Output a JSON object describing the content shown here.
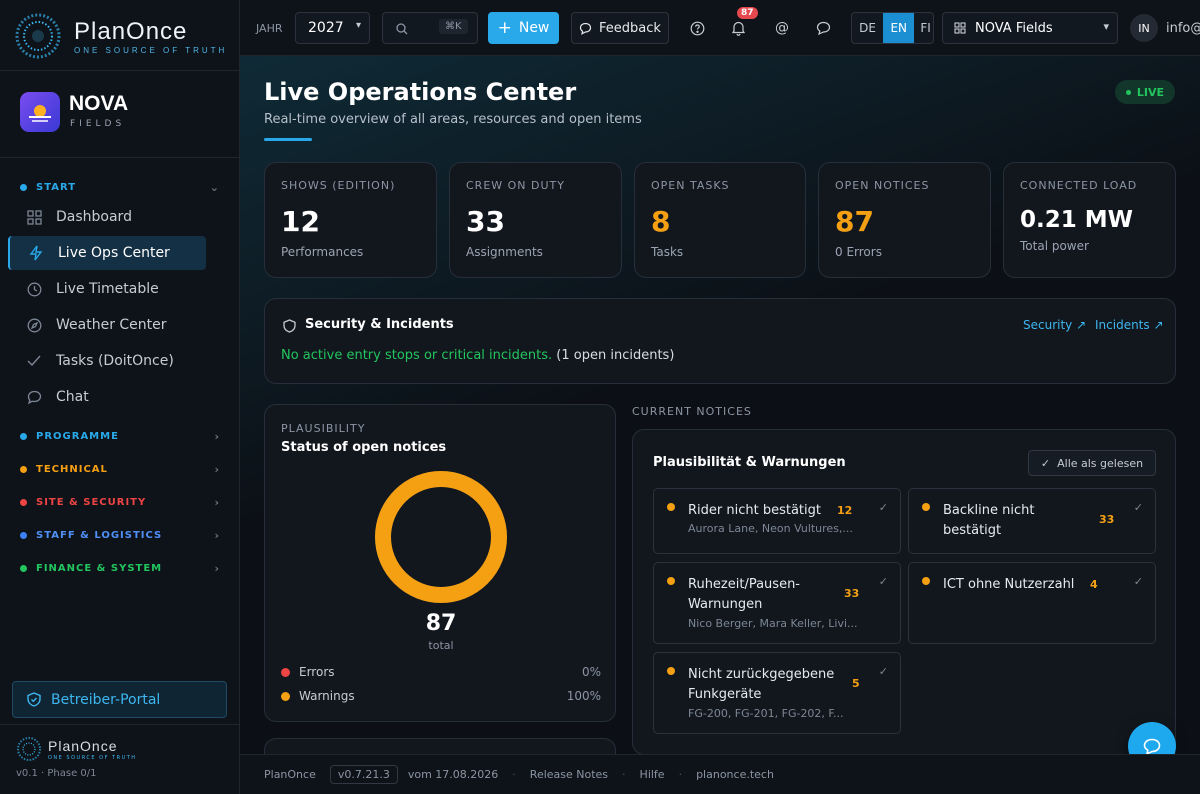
{
  "brand": {
    "name": "PlanOnce",
    "tagline": "ONE SOURCE OF TRUTH"
  },
  "app": {
    "name": "NOVA",
    "sub": "FIELDS"
  },
  "sidebar": {
    "start": {
      "label": "START",
      "color": "#29a9ea"
    },
    "items": [
      {
        "label": "Dashboard",
        "icon": "grid-icon"
      },
      {
        "label": "Live Ops Center",
        "icon": "bolt-icon"
      },
      {
        "label": "Live Timetable",
        "icon": "clock-icon"
      },
      {
        "label": "Weather Center",
        "icon": "compass-icon"
      },
      {
        "label": "Tasks (DoitOnce)",
        "icon": "check-icon"
      },
      {
        "label": "Chat",
        "icon": "chat-icon"
      }
    ],
    "sections": [
      {
        "label": "PROGRAMME",
        "color": "#29a9ea"
      },
      {
        "label": "TECHNICAL",
        "color": "#f5a013"
      },
      {
        "label": "SITE & SECURITY",
        "color": "#ef4444"
      },
      {
        "label": "STAFF & LOGISTICS",
        "color": "#3b82f6"
      },
      {
        "label": "FINANCE & SYSTEM",
        "color": "#22c55e"
      }
    ],
    "portal": "Betreiber-Portal",
    "version": "v0.1 · Phase 0/1"
  },
  "topbar": {
    "year_label": "JAHR",
    "year": "2027",
    "search_shortcut": "⌘K",
    "new_label": "New",
    "feedback_label": "Feedback",
    "notif_count": "87",
    "langs": [
      "DE",
      "EN",
      "FI"
    ],
    "active_lang": "EN",
    "workspace": "NOVA Fields",
    "avatar": "IN",
    "user": "info@"
  },
  "page": {
    "title": "Live Operations Center",
    "subtitle": "Real-time overview of all areas, resources and open items",
    "live": "LIVE"
  },
  "stats": [
    {
      "label": "SHOWS (EDITION)",
      "value": "12",
      "sub": "Performances",
      "color": "#ffffff"
    },
    {
      "label": "CREW ON DUTY",
      "value": "33",
      "sub": "Assignments",
      "color": "#ffffff"
    },
    {
      "label": "OPEN TASKS",
      "value": "8",
      "sub": "Tasks",
      "color": "#f5a013"
    },
    {
      "label": "OPEN NOTICES",
      "value": "87",
      "sub": "0 Errors",
      "color": "#f5a013"
    },
    {
      "label": "CONNECTED LOAD",
      "value": "0.21 MW",
      "sub": "Total power",
      "color": "#ffffff"
    }
  ],
  "security": {
    "title": "Security & Incidents",
    "link1": "Security ↗",
    "link2": "Incidents ↗",
    "ok": "No active entry stops or critical incidents.",
    "open": "(1 open incidents)"
  },
  "plausibility": {
    "eyebrow": "PLAUSIBILITY",
    "title": "Status of open notices",
    "total": "87",
    "total_label": "total",
    "legend": [
      {
        "label": "Errors",
        "value": "0%",
        "color": "#ef4444"
      },
      {
        "label": "Warnings",
        "value": "100%",
        "color": "#f5a013"
      }
    ],
    "warnings_fraction": 1.0
  },
  "notices": {
    "eyebrow": "CURRENT NOTICES",
    "title": "Plausibilität & Warnungen",
    "mark_all": "Alle als gelesen",
    "items": [
      {
        "title": "Rider nicht bestätigt",
        "count": "12",
        "sub": "Aurora Lane, Neon Vultures,..."
      },
      {
        "title": "Backline nicht bestätigt",
        "count": "33",
        "sub": ""
      },
      {
        "title": "Ruhezeit/Pausen-Warnungen",
        "count": "33",
        "sub": "Nico Berger, Mara Keller, Livi..."
      },
      {
        "title": "ICT ohne Nutzerzahl",
        "count": "4",
        "sub": ""
      },
      {
        "title": "Nicht zurückgegebene Funkgeräte",
        "count": "5",
        "sub": "FG-200, FG-201, FG-202, F..."
      }
    ]
  },
  "footer": {
    "brand": "PlanOnce",
    "version": "v0.7.21.3",
    "date": "vom 17.08.2026",
    "release": "Release Notes",
    "help": "Hilfe",
    "site": "planonce.tech"
  }
}
